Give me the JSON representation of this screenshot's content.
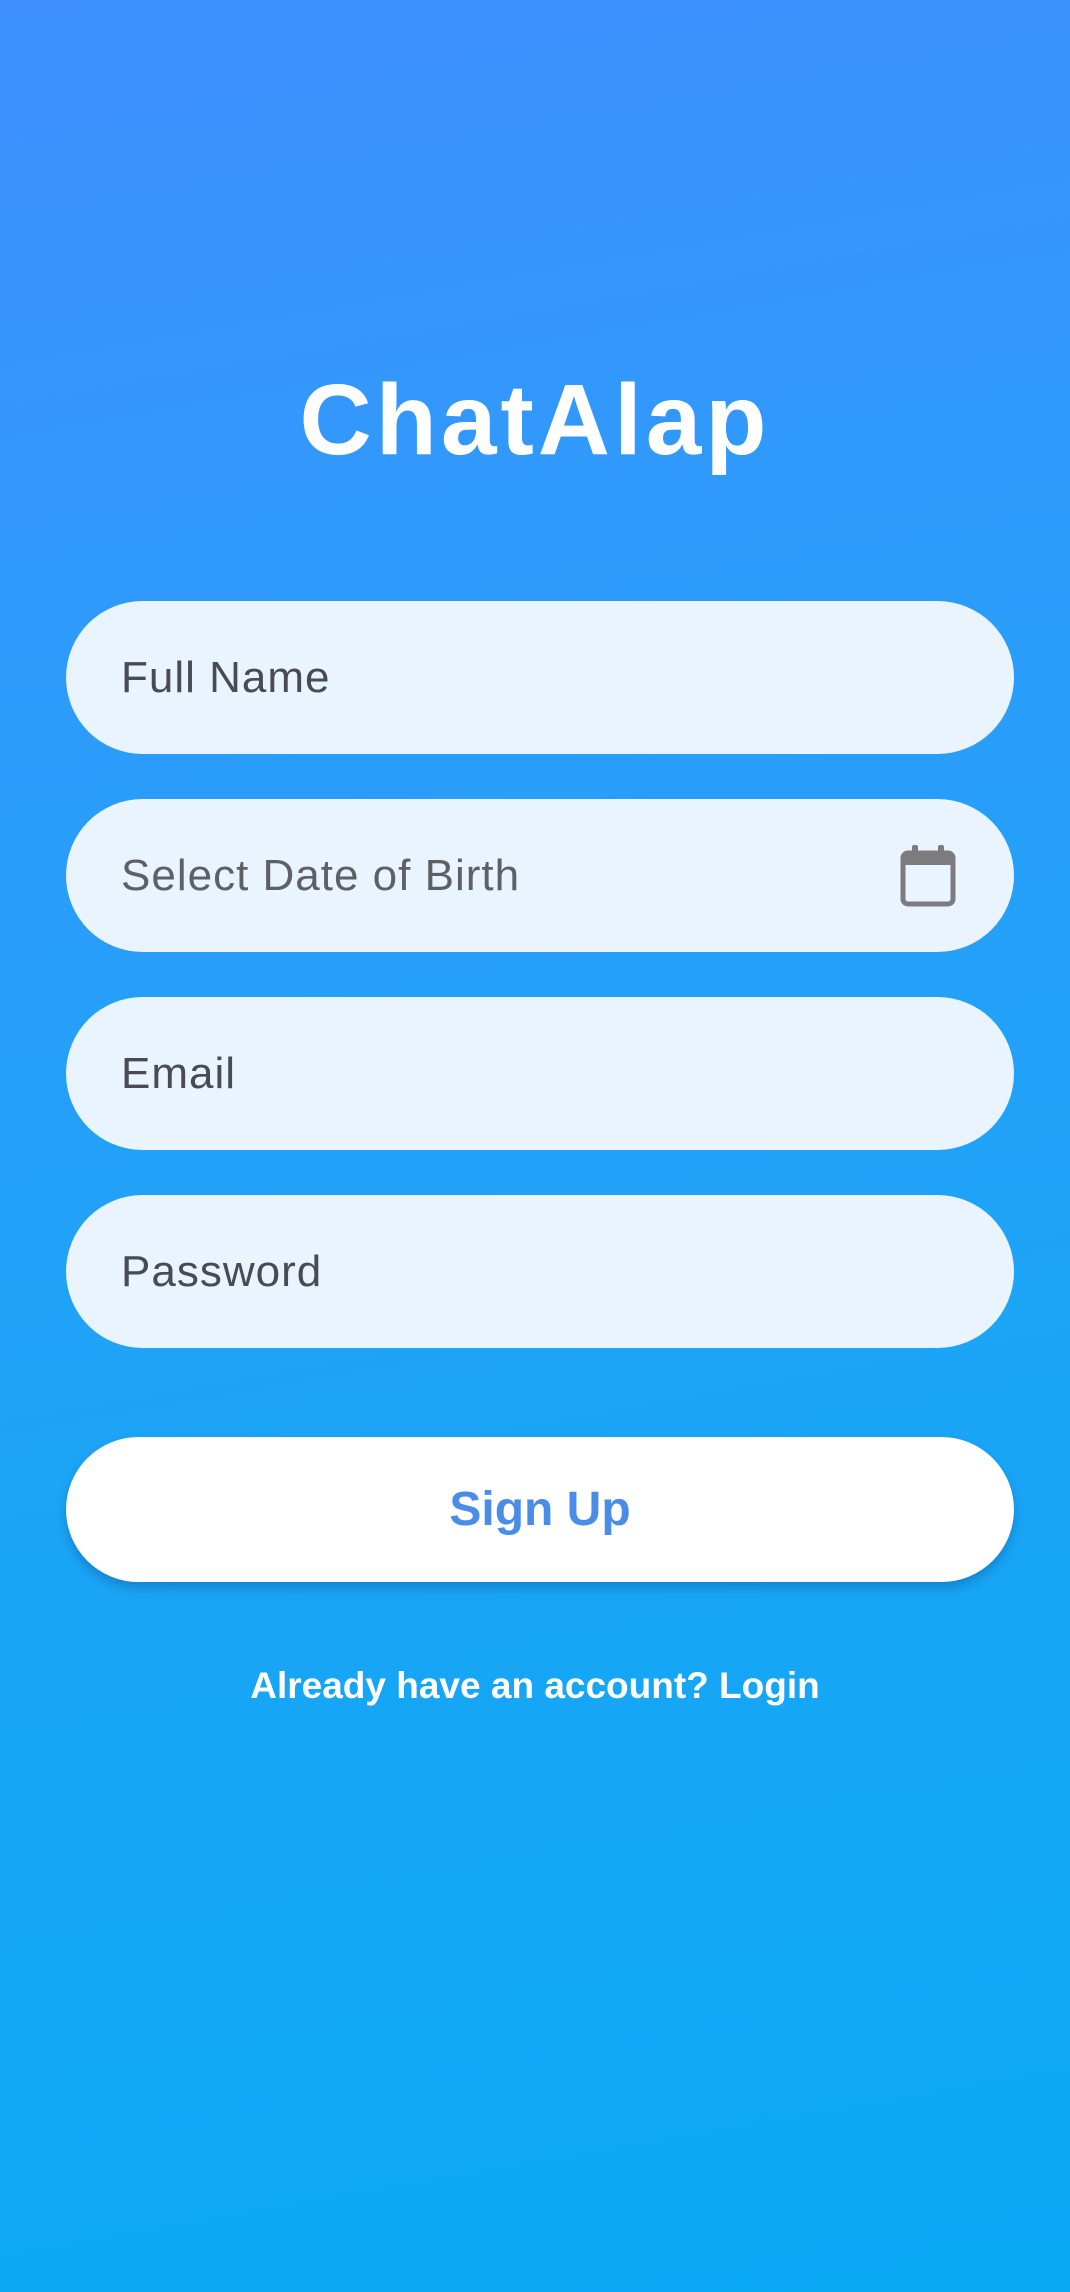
{
  "app": {
    "title": "ChatAlap"
  },
  "form": {
    "full_name": {
      "placeholder": "Full Name"
    },
    "date_of_birth": {
      "placeholder": "Select Date of Birth",
      "icon": "calendar-icon"
    },
    "email": {
      "placeholder": "Email"
    },
    "password": {
      "placeholder": "Password"
    }
  },
  "actions": {
    "signup_label": "Sign Up",
    "login_prompt": "Already have an account? Login"
  },
  "colors": {
    "background_top": "#3f8ffe",
    "background_bottom": "#09a9f4",
    "field_background": "#e9f4fe",
    "button_background": "#ffffff",
    "button_text": "#4a8de8"
  }
}
